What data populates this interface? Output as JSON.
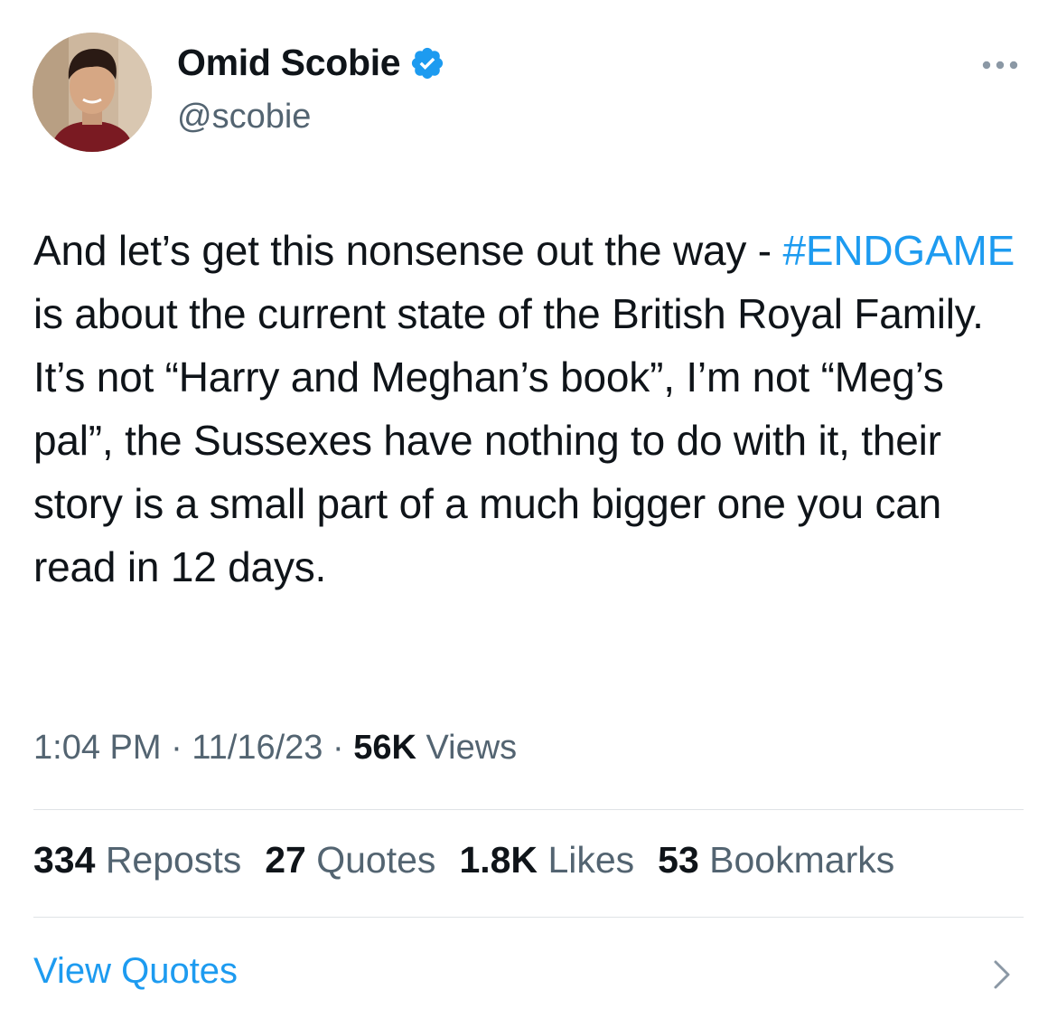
{
  "author": {
    "display_name": "Omid Scobie",
    "handle": "@scobie",
    "verified_icon": "verified-badge-icon",
    "avatar_icon": "profile-avatar"
  },
  "tweet": {
    "text_part1": "And let’s get this nonsense out the way - ",
    "hashtag": "#ENDGAME",
    "text_part2": " is about the current state of the British Royal Family. It’s not “Harry and Meghan’s book”, I’m not “Meg’s pal”, the Sussexes have nothing to do with it, their story is a small part of a much bigger one you can read in 12 days."
  },
  "meta": {
    "time": "1:04 PM",
    "sep1": " · ",
    "date": "11/16/23",
    "sep2": " · ",
    "views_count": "56K",
    "views_label": " Views"
  },
  "stats": [
    {
      "count": "334",
      "label": " Reposts"
    },
    {
      "count": "27",
      "label": " Quotes"
    },
    {
      "count": "1.8K",
      "label": " Likes"
    },
    {
      "count": "53",
      "label": " Bookmarks"
    }
  ],
  "view_quotes_label": "View Quotes",
  "colors": {
    "accent": "#1d9bf0",
    "text": "#0f1419",
    "secondary": "#536471",
    "divider": "#dfe3e6"
  }
}
